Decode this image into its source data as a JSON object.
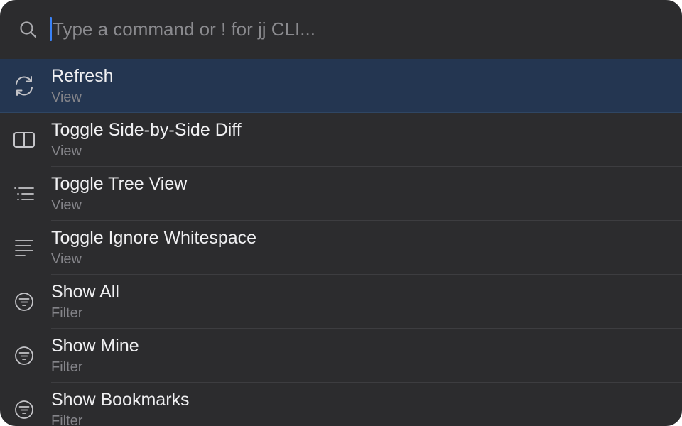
{
  "search": {
    "placeholder": "Type a command or ! for jj CLI...",
    "icon": "search-icon"
  },
  "colors": {
    "background": "#2c2c2e",
    "selected_row": "#243651",
    "caret": "#3a82f7"
  },
  "commands": [
    {
      "title": "Refresh",
      "category": "View",
      "icon": "refresh-icon",
      "selected": true
    },
    {
      "title": "Toggle Side-by-Side Diff",
      "category": "View",
      "icon": "split-view-icon",
      "selected": false
    },
    {
      "title": "Toggle Tree View",
      "category": "View",
      "icon": "tree-list-icon",
      "selected": false
    },
    {
      "title": "Toggle Ignore Whitespace",
      "category": "View",
      "icon": "text-align-icon",
      "selected": false
    },
    {
      "title": "Show All",
      "category": "Filter",
      "icon": "filter-circle-icon",
      "selected": false
    },
    {
      "title": "Show Mine",
      "category": "Filter",
      "icon": "filter-circle-icon",
      "selected": false
    },
    {
      "title": "Show Bookmarks",
      "category": "Filter",
      "icon": "filter-circle-icon",
      "selected": false
    }
  ]
}
